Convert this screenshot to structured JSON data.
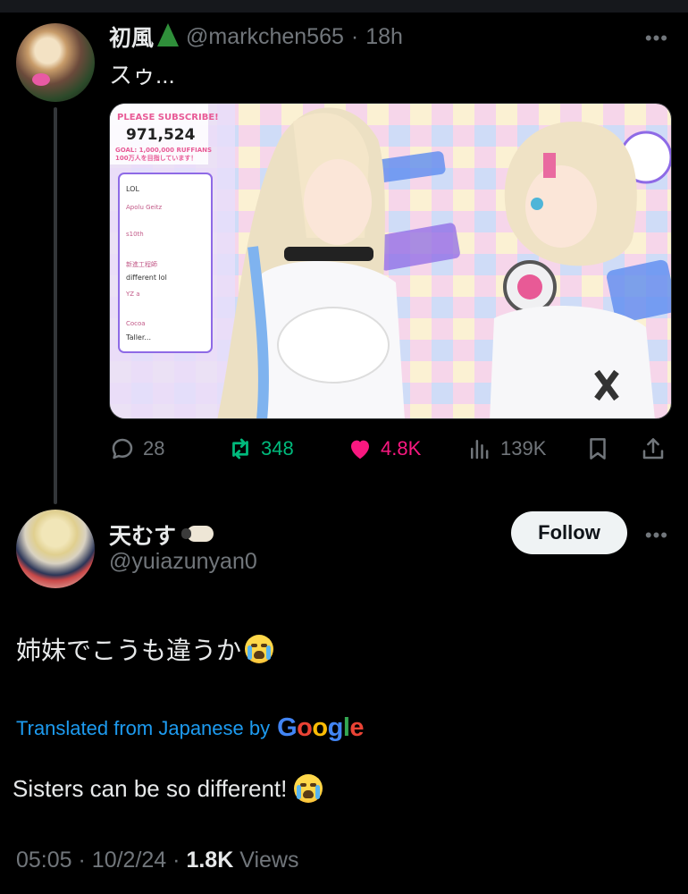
{
  "parent_post": {
    "author_name": "初風",
    "author_name_icon": "pine-tree-icon",
    "handle": "@markchen565",
    "separator": "·",
    "time": "18h",
    "more": "•••",
    "text": "スゥ...",
    "media": {
      "overlay_lines": [
        "PLEASE SUBSCRIBE!",
        "971,524",
        "GOAL: 1,000,000 RUFFIANS",
        "100万人を目指しています！"
      ],
      "chat_lines": [
        "LOL",
        "Apolu Geitz",
        "s10th",
        "新進工程師",
        "different lol",
        "YZ a",
        "Cocoa",
        "Taller..."
      ]
    },
    "actions": {
      "replies": "28",
      "reposts": "348",
      "likes": "4.8K",
      "views": "139K"
    }
  },
  "main_post": {
    "author_name": "天むす",
    "author_name_icon": "sheep-icon",
    "handle": "@yuiazunyan0",
    "follow_label": "Follow",
    "more": "•••",
    "text": "姉妹でこうも違うか",
    "text_emoji": "loudly-crying-face-icon",
    "translated_label": "Translated from Japanese by",
    "google_letters": [
      "G",
      "o",
      "o",
      "g",
      "l",
      "e"
    ],
    "translation": "Sisters can be so different!",
    "time": "05:05",
    "date": "10/2/24",
    "view_count": "1.8K",
    "views_label": "Views"
  },
  "colors": {
    "background": "#000000",
    "accent_blue": "#1d9bf0",
    "repost_green": "#00ba7c",
    "like_pink": "#f91880",
    "muted": "#71767b"
  }
}
